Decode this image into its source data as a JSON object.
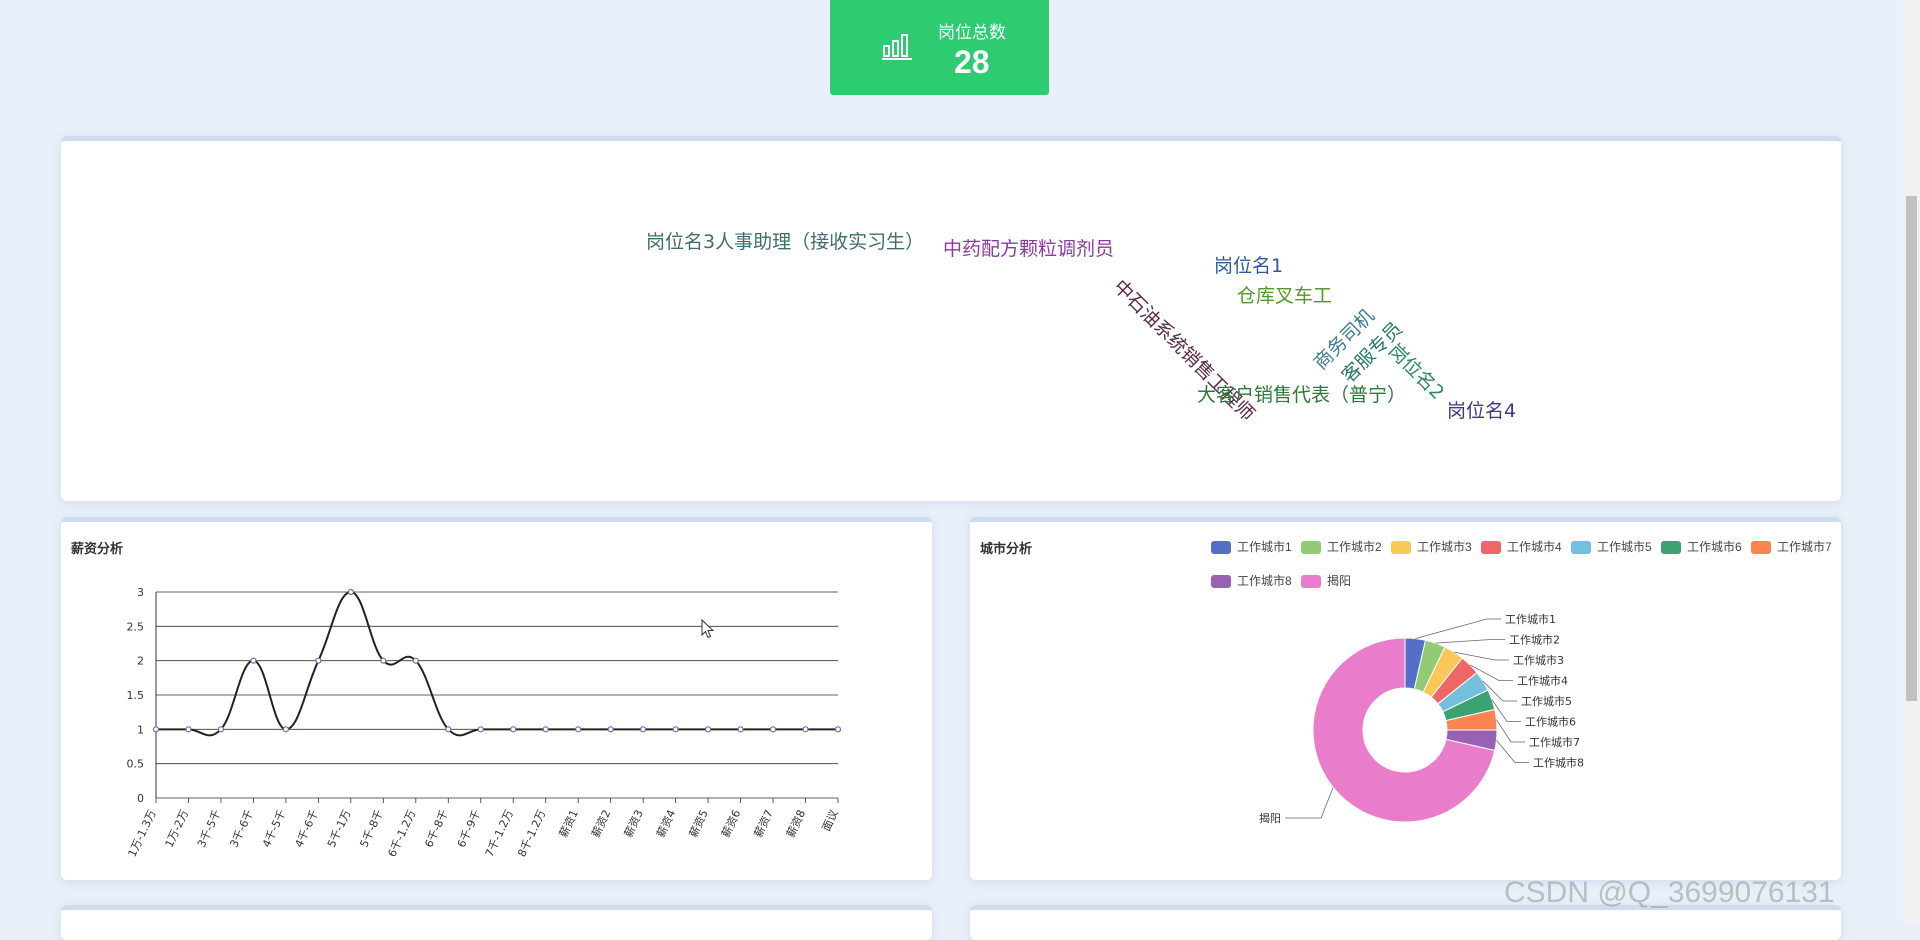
{
  "stat": {
    "label": "岗位总数",
    "value": "28",
    "icon": "bar-chart-icon",
    "color": "#2ecc71"
  },
  "wordcloud": {
    "words": [
      {
        "text": "岗位名3人事助理（接收实习生）",
        "color": "#3e6e6e"
      },
      {
        "text": "中药配方颗粒调剂员",
        "color": "#8a3aa0"
      },
      {
        "text": "中石油系统销售工程师",
        "color": "#5a2a4a"
      },
      {
        "text": "岗位名1",
        "color": "#2f5aa0"
      },
      {
        "text": "仓库叉车工",
        "color": "#4f9a2a"
      },
      {
        "text": "商务司机",
        "color": "#3a7a9a"
      },
      {
        "text": "客服专员",
        "color": "#2a7a6a"
      },
      {
        "text": "岗位名2",
        "color": "#2a8a5a"
      },
      {
        "text": "大客户销售代表（普宁）",
        "color": "#2a7a3a"
      },
      {
        "text": "岗位名4",
        "color": "#3a3a8a"
      }
    ]
  },
  "salary": {
    "title": "薪资分析"
  },
  "city": {
    "title": "城市分析"
  },
  "watermark": "CSDN @Q_3699076131",
  "chart_data": [
    {
      "type": "line",
      "title": "薪资分析",
      "categories": [
        "1万-1.3万",
        "1万-2万",
        "3千-5千",
        "3千-6千",
        "4千-5千",
        "4千-6千",
        "5千-1万",
        "5千-8千",
        "6千-1.2万",
        "6千-8千",
        "6千-9千",
        "7千-1.2万",
        "8千-1.2万",
        "薪资1",
        "薪资2",
        "薪资3",
        "薪资4",
        "薪资5",
        "薪资6",
        "薪资7",
        "薪资8",
        "面议"
      ],
      "values": [
        1,
        1,
        1,
        2,
        1,
        2,
        3,
        2,
        2,
        1,
        1,
        1,
        1,
        1,
        1,
        1,
        1,
        1,
        1,
        1,
        1,
        1
      ],
      "ylim": [
        0,
        3
      ],
      "yticks": [
        0,
        0.5,
        1,
        1.5,
        2,
        2.5,
        3
      ],
      "smooth": true,
      "grid": true,
      "color": "#222222",
      "point_color": "#5470c6"
    },
    {
      "type": "pie",
      "title": "城市分析",
      "donut": true,
      "legend_position": "top-right",
      "labels": [
        "工作城市1",
        "工作城市2",
        "工作城市3",
        "工作城市4",
        "工作城市5",
        "工作城市6",
        "工作城市7",
        "工作城市8",
        "揭阳"
      ],
      "values": [
        1,
        1,
        1,
        1,
        1,
        1,
        1,
        1,
        20
      ],
      "colors": [
        "#5470c6",
        "#91cc75",
        "#fac858",
        "#ee6666",
        "#73c0de",
        "#3ba272",
        "#fc8452",
        "#9a60b4",
        "#ea7ccc"
      ]
    }
  ]
}
